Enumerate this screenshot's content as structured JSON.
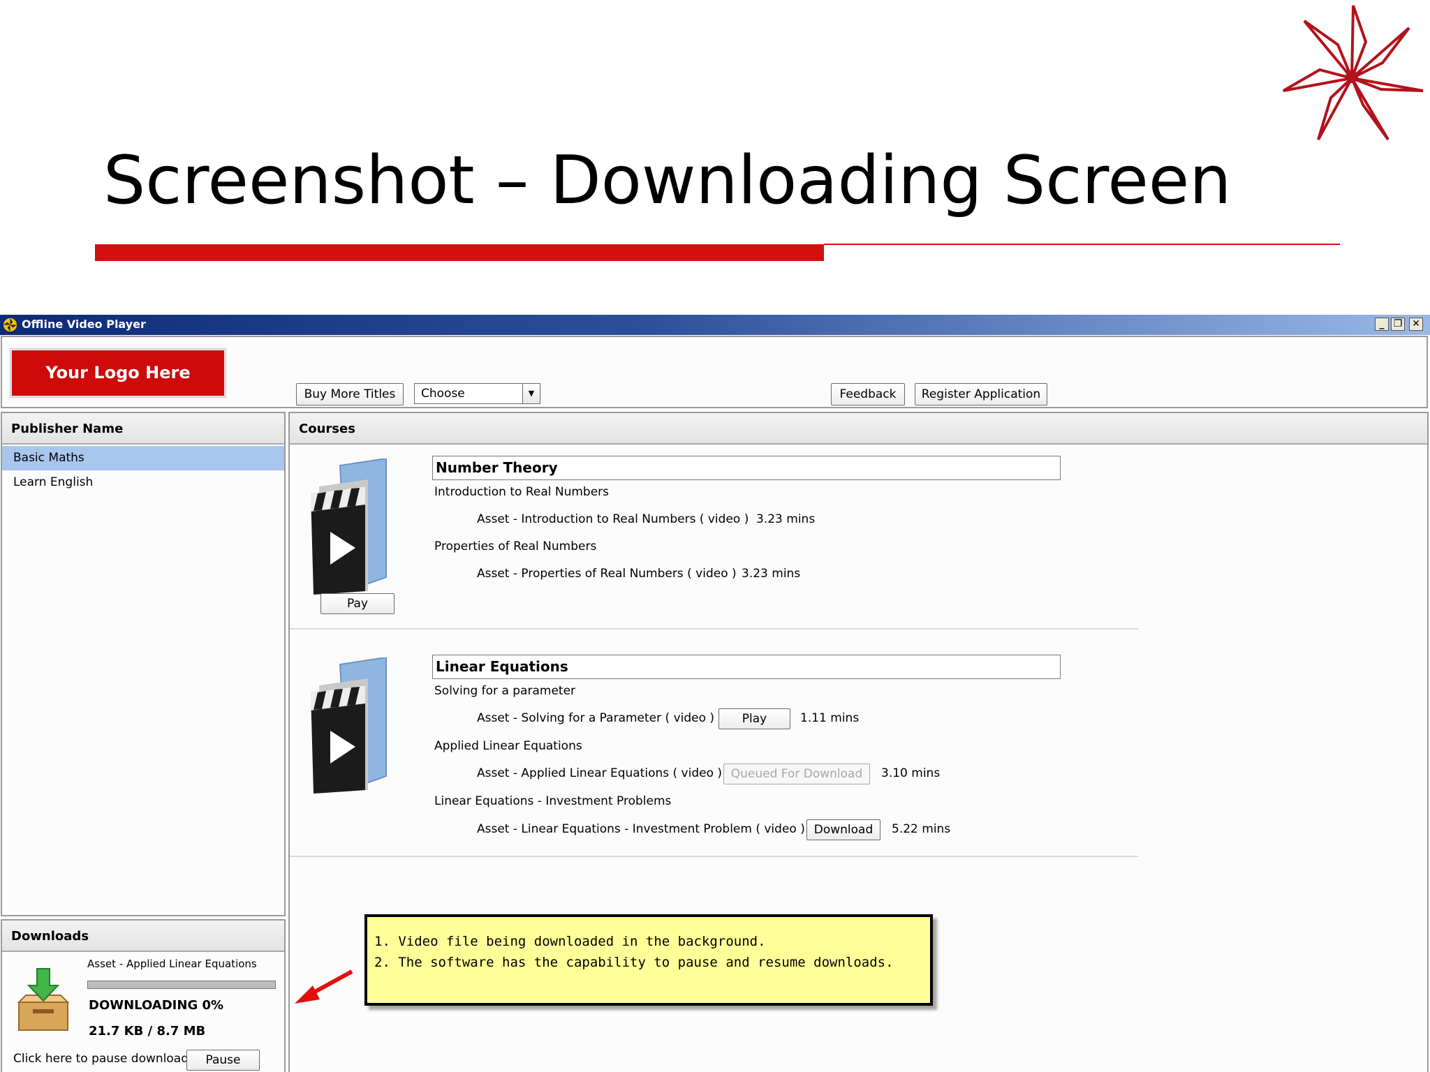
{
  "slide": {
    "title": "Screenshot – Downloading Screen",
    "accent_color": "#d21010",
    "corner_graphic_icon": "pinwheel-icon"
  },
  "window": {
    "title": "Offline Video Player",
    "title_icon": "app-pinwheel-icon",
    "controls": {
      "minimize": "_",
      "maximize": "❐",
      "close": "✕"
    }
  },
  "toolbar": {
    "logo_text": "Your Logo Here",
    "buy_more_label": "Buy More Titles",
    "choose_value": "Choose",
    "feedback_label": "Feedback",
    "register_label": "Register Application"
  },
  "sidebar": {
    "header": "Publisher Name",
    "items": [
      {
        "label": "Basic Maths",
        "selected": true
      },
      {
        "label": "Learn English",
        "selected": false
      }
    ]
  },
  "courses": {
    "header": "Courses",
    "list": [
      {
        "title": "Number Theory",
        "icon": "video-clapperboard-icon",
        "action_label": "Pay",
        "sections": [
          {
            "name": "Introduction to Real Numbers",
            "asset": "Asset - Introduction to Real Numbers ( video )",
            "duration": "3.23 mins"
          },
          {
            "name": "Properties of Real Numbers",
            "asset": "Asset - Properties of Real Numbers ( video )",
            "duration": "3.23 mins"
          }
        ]
      },
      {
        "title": "Linear Equations",
        "icon": "video-clapperboard-icon",
        "sections": [
          {
            "name": "Solving for a parameter",
            "asset": "Asset - Solving for a Parameter ( video )",
            "button": "Play",
            "duration": "1.11 mins"
          },
          {
            "name": "Applied Linear Equations",
            "asset": "Asset - Applied Linear Equations ( video )",
            "button": "Queued For Download",
            "button_disabled": true,
            "duration": "3.10 mins"
          },
          {
            "name": "Linear Equations - Investment Problems",
            "asset": "Asset - Linear Equations - Investment Problem ( video )",
            "button": "Download",
            "duration": "5.22 mins"
          }
        ]
      }
    ]
  },
  "downloads": {
    "header": "Downloads",
    "icon": "download-box-icon",
    "asset": "Asset - Applied Linear Equations",
    "progress_fraction": 0.0,
    "status": "DOWNLOADING 0%",
    "size": "21.7 KB / 8.7 MB",
    "hint": "Click here to pause download",
    "pause_label": "Pause"
  },
  "annotation": {
    "lines": [
      "1. Video file being downloaded in the background.",
      "2. The software has the capability to pause and resume downloads."
    ],
    "pointer_icon": "red-arrow-icon",
    "color": "#ffff99"
  }
}
